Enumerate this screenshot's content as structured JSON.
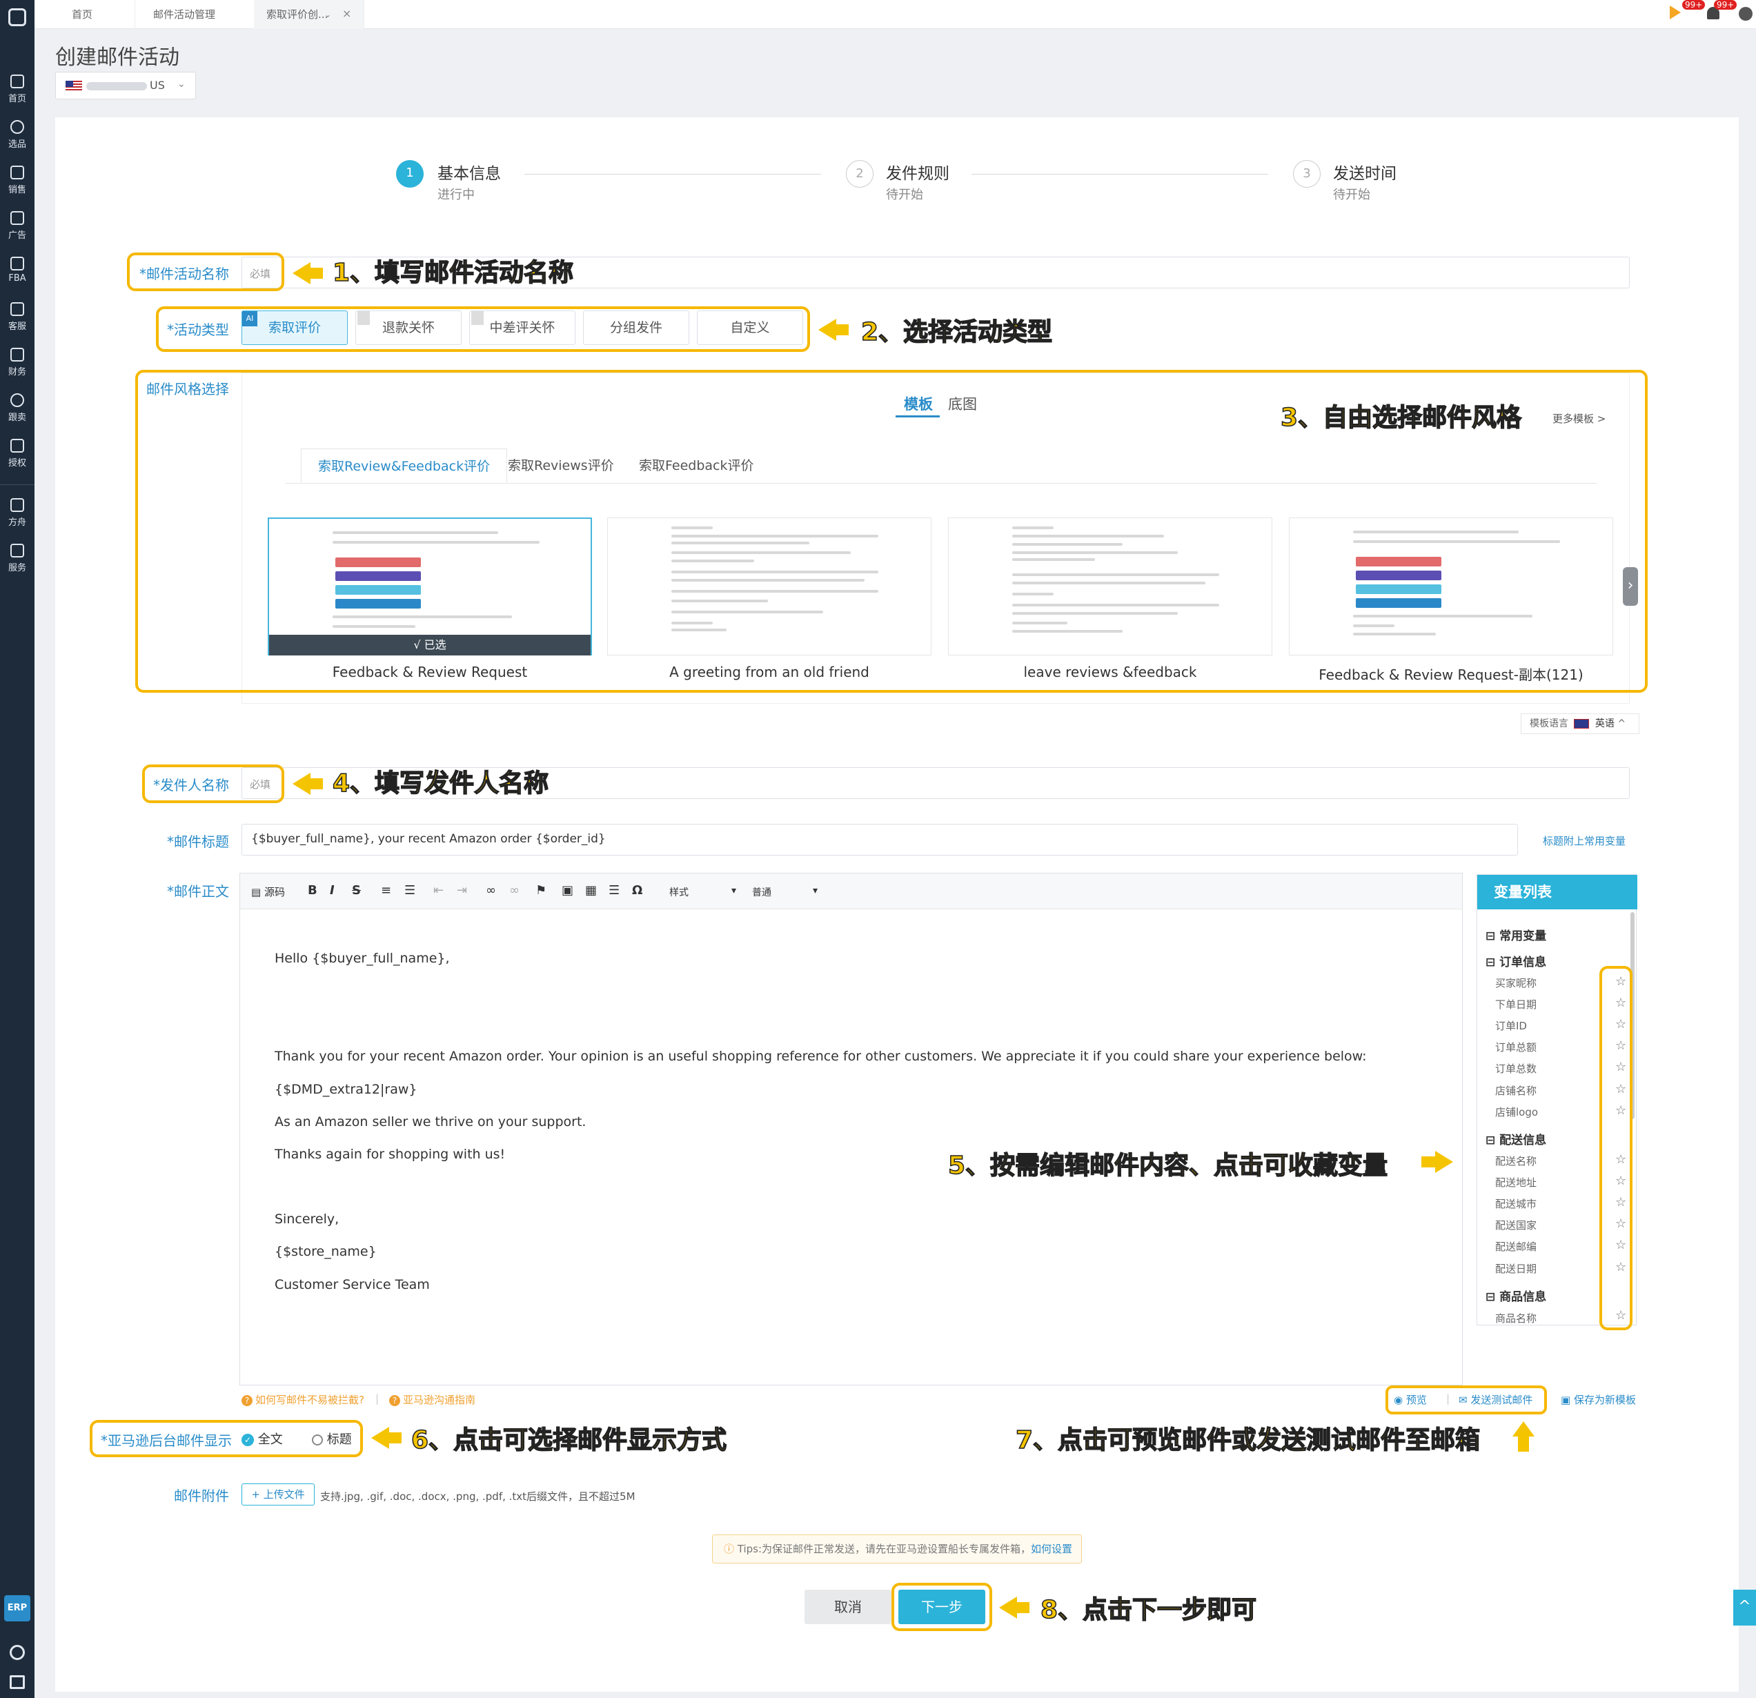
{
  "tabs": [
    "首页",
    "邮件活动管理",
    "索取评价创..."
  ],
  "badges": {
    "msg": "99+",
    "bell": "99+"
  },
  "sidebar": {
    "items": [
      {
        "label": "首页",
        "icon": "home-icon"
      },
      {
        "label": "选品",
        "icon": "search-icon"
      },
      {
        "label": "销售",
        "icon": "chart-icon"
      },
      {
        "label": "广告",
        "icon": "ad-icon"
      },
      {
        "label": "FBA",
        "icon": "warehouse-icon"
      },
      {
        "label": "客服",
        "icon": "service-icon"
      },
      {
        "label": "财务",
        "icon": "finance-icon"
      },
      {
        "label": "跟卖",
        "icon": "pie-icon"
      },
      {
        "label": "授权",
        "icon": "shield-icon"
      },
      {
        "label": "方舟",
        "icon": "ark-icon"
      },
      {
        "label": "服务",
        "icon": "building-icon"
      }
    ],
    "erp": "ERP"
  },
  "page": {
    "title": "创建邮件活动",
    "store_suffix": "US"
  },
  "steps": [
    {
      "num": "1",
      "title": "基本信息",
      "sub": "进行中"
    },
    {
      "num": "2",
      "title": "发件规则",
      "sub": "待开始"
    },
    {
      "num": "3",
      "title": "发送时间",
      "sub": "待开始"
    }
  ],
  "form": {
    "name_label": "*邮件活动名称",
    "required": "必填",
    "type_label": "*活动类型",
    "types": [
      "索取评价",
      "退款关怀",
      "中差评关怀",
      "分组发件",
      "自定义"
    ],
    "ai_tag": "AI",
    "style_label": "邮件风格选择",
    "style_tabs": [
      "模板",
      "底图"
    ],
    "more_templates": "更多模板 >",
    "sub_tabs": [
      "索取Review&Feedback评价",
      "索取Reviews评价",
      "索取Feedback评价"
    ],
    "templates": [
      "Feedback & Review Request",
      "A greeting from an old friend",
      "leave reviews &feedback",
      "Feedback & Review Request-副本(121)"
    ],
    "selected_text": "√ 已选",
    "tmpl_lang_label": "模板语言",
    "tmpl_lang": "英语",
    "sender_label": "*发件人名称",
    "subject_label": "*邮件标题",
    "subject_value": "{$buyer_full_name}, your recent Amazon order {$order_id}",
    "subject_link": "标题附上常用变量",
    "body_label": "*邮件正文",
    "display_label": "*亚马逊后台邮件显示",
    "display_opts": [
      "全文",
      "标题"
    ],
    "attach_label": "邮件附件",
    "upload_btn": "+ 上传文件",
    "attach_hint": "支持.jpg, .gif, .doc, .docx, .png, .pdf, .txt后缀文件，且不超过5M"
  },
  "toolbar": {
    "source": "源码",
    "style": "样式",
    "normal": "普通"
  },
  "body": [
    "Hello {$buyer_full_name},",
    "Thank you for your recent Amazon order. Your opinion is an useful shopping reference for other customers. We appreciate it if you could share your experience below:",
    "{$DMD_extra12|raw}",
    "As an Amazon seller we thrive on your support.",
    "Thanks again for shopping with us!",
    "Sincerely,",
    "{$store_name}",
    "Customer Service Team"
  ],
  "vars": {
    "title": "变量列表",
    "common": "常用变量",
    "order": "订单信息",
    "order_items": [
      "买家昵称",
      "下单日期",
      "订单ID",
      "订单总额",
      "订单总数",
      "店铺名称",
      "店铺logo"
    ],
    "ship": "配送信息",
    "ship_items": [
      "配送名称",
      "配送地址",
      "配送城市",
      "配送国家",
      "配送邮编",
      "配送日期"
    ],
    "product": "商品信息",
    "product_items": [
      "商品名称"
    ]
  },
  "links": {
    "spam": "如何写邮件不易被拦截?",
    "guide": "亚马逊沟通指南",
    "preview": "预览",
    "send_test": "发送测试邮件",
    "save_tmpl": "保存为新模板"
  },
  "tips": {
    "text": "Tips:为保证邮件正常发送，请先在亚马逊设置船长专属发件箱，",
    "link": "如何设置"
  },
  "buttons": {
    "cancel": "取消",
    "next": "下一步"
  },
  "annotations": [
    "1、填写邮件活动名称",
    "2、选择活动类型",
    "3、自由选择邮件风格",
    "4、填写发件人名称",
    "5、按需编辑邮件内容、点击可收藏变量",
    "6、点击可选择邮件显示方式",
    "7、点击可预览邮件或发送测试邮件至邮箱",
    "8、点击下一步即可"
  ],
  "colors": {
    "accent": "#2bb3d9",
    "highlight": "#f5b800",
    "sidebar": "#1e2b3b"
  }
}
